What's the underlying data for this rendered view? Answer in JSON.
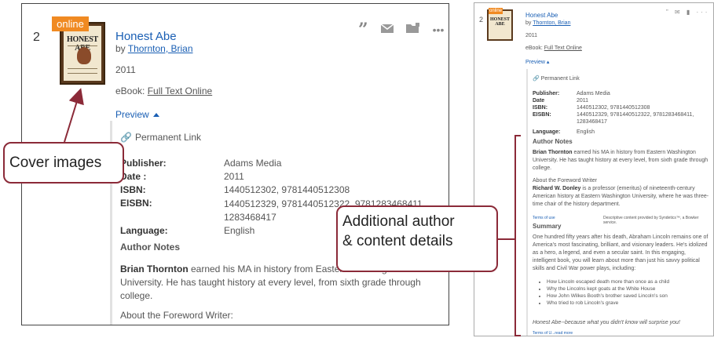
{
  "left": {
    "record_number": "2",
    "badge": "online",
    "cover_title": "HONEST ABE",
    "title": "Honest Abe",
    "by_prefix": "by ",
    "author": "Thornton, Brian",
    "year": "2011",
    "ebook_prefix": "eBook: ",
    "ebook_link": "Full Text Online",
    "preview": "Preview",
    "permanent_link": "Permanent Link",
    "meta": [
      {
        "k": "Publisher:",
        "v": "Adams Media"
      },
      {
        "k": "Date :",
        "v": "2011"
      },
      {
        "k": "ISBN:",
        "v": "1440512302, 9781440512308"
      },
      {
        "k": "EISBN:",
        "v": "1440512329, 9781440512322, 9781283468411, 1283468417"
      },
      {
        "k": "Language:",
        "v": "English"
      }
    ],
    "author_notes": "Author Notes",
    "bio_name": "Brian Thornton",
    "bio_text": " earned his MA in history from Eastern Washington University. He has taught history at every level, from sixth grade through college.",
    "foreword": "About the Foreword Writer:"
  },
  "right": {
    "record_number": "2",
    "badge": "online",
    "cover_title": "HONEST ABE",
    "title": "Honest Abe",
    "by_prefix": "by ",
    "author": "Thornton, Brian",
    "year": "2011",
    "ebook_prefix": "eBook: ",
    "ebook_link": "Full Text Online",
    "preview": "Preview",
    "permanent_link": "Permanent Link",
    "meta": [
      {
        "k": "Publisher:",
        "v": "Adams Media"
      },
      {
        "k": "Date :",
        "v": "2011"
      },
      {
        "k": "ISBN:",
        "v": "1440512302, 9781440512308"
      },
      {
        "k": "EISBN:",
        "v": "1440512329, 9781440512322, 9781283468411, 1283468417"
      },
      {
        "k": "Language:",
        "v": "English"
      }
    ],
    "author_notes": "Author Notes",
    "bio_name": "Brian Thornton",
    "bio_text": " earned his MA in history from Eastern Washington University. He has taught history at every level, from sixth grade through college.",
    "foreword_head": "About the Foreword Writer",
    "foreword_name": "Richard W. Donley",
    "foreword_text": " is a professor (emeritus) of nineteenth-century American history at Eastern Washington University, where he was three-time chair of the history department.",
    "terms": "Terms of use",
    "credit": "Descriptive content provided by Syndetics™, a Bowker service.",
    "summary_head": "Summary",
    "summary": "One hundred fifty years after his death, Abraham Lincoln remains one of America's most fascinating, brilliant, and visionary leaders. He's idolized as a hero, a legend, and even a secular saint. In this engaging, intelligent book, you will learn about more than just his savvy political skills and Civil War power plays, including:",
    "bullets": [
      "How Lincoln escaped death more than once as a child",
      "Why the Lincolns kept goats at the White House",
      "How John Wilkes Booth's brother saved Lincoln's son",
      "Who tried to rob Lincoln's grave"
    ],
    "closing": "Honest Abe--because what you didn't know will surprise you!",
    "terms2": "Terms of U...read more"
  },
  "callouts": {
    "cover": "Cover images",
    "details_line1": "Additional author",
    "details_line2": "& content details"
  },
  "colors": {
    "link": "#1a5fb4",
    "badge": "#f08a22",
    "callout_border": "#8b2a38"
  }
}
